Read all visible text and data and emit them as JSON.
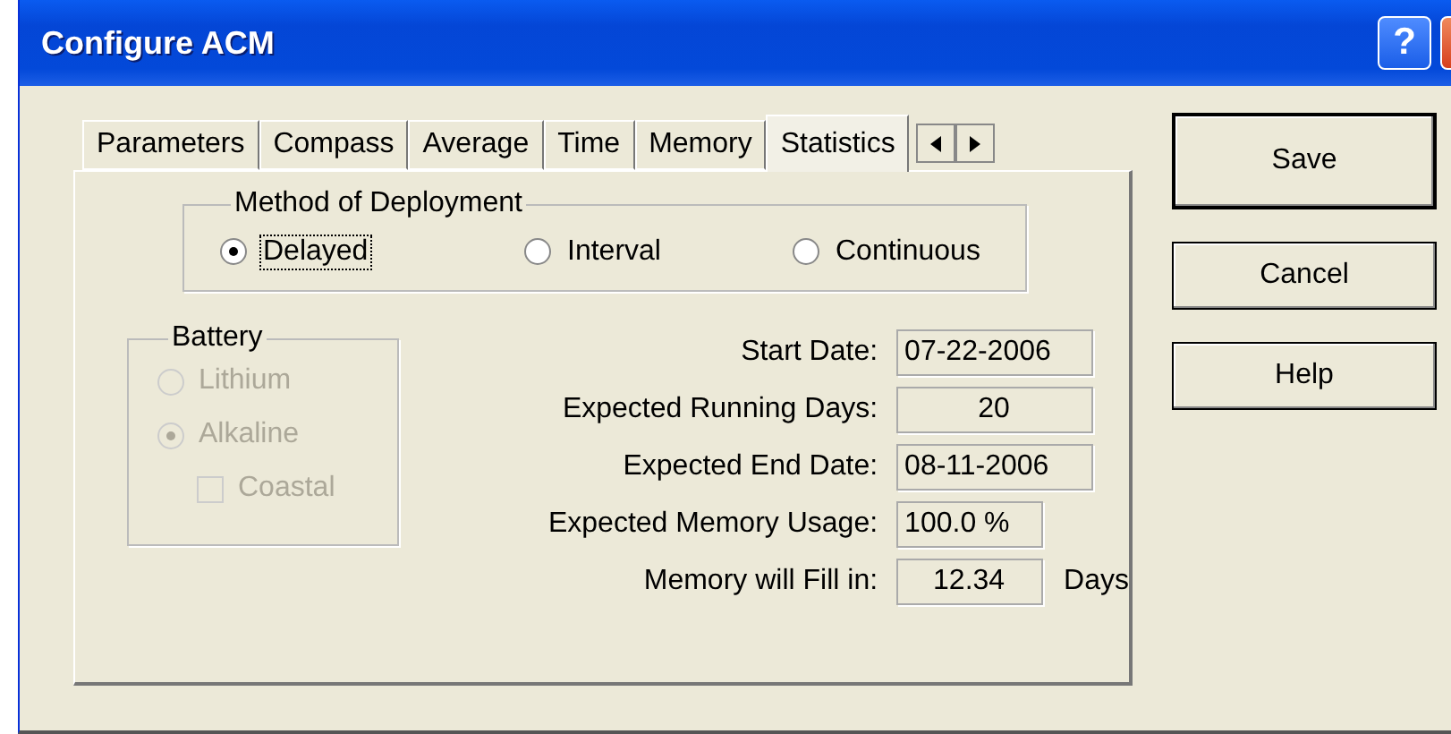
{
  "window": {
    "title": "Configure ACM",
    "help_button": "?"
  },
  "tabs": [
    {
      "label": "Parameters",
      "selected": false
    },
    {
      "label": "Compass",
      "selected": false
    },
    {
      "label": "Average",
      "selected": false
    },
    {
      "label": "Time",
      "selected": false
    },
    {
      "label": "Memory",
      "selected": false
    },
    {
      "label": "Statistics",
      "selected": true
    }
  ],
  "deployment": {
    "title": "Method of Deployment",
    "options": [
      {
        "label": "Delayed",
        "selected": true,
        "focused": true
      },
      {
        "label": "Interval",
        "selected": false,
        "focused": false
      },
      {
        "label": "Continuous",
        "selected": false,
        "focused": false
      }
    ]
  },
  "battery": {
    "title": "Battery",
    "disabled": true,
    "options": [
      {
        "label": "Lithium",
        "selected": false
      },
      {
        "label": "Alkaline",
        "selected": true
      }
    ],
    "coastal": {
      "label": "Coastal",
      "checked": false
    }
  },
  "fields": [
    {
      "label": "Start Date:",
      "value": "07-22-2006",
      "centered": false,
      "wide": true
    },
    {
      "label": "Expected Running Days:",
      "value": "20",
      "centered": true,
      "wide": true
    },
    {
      "label": "Expected End Date:",
      "value": "08-11-2006",
      "centered": false,
      "wide": true
    },
    {
      "label": "Expected Memory Usage:",
      "value": "100.0 %",
      "centered": false,
      "wide": false
    },
    {
      "label": "Memory will Fill in:",
      "value": "12.34",
      "unit": "Days",
      "centered": true,
      "wide": false
    }
  ],
  "buttons": [
    {
      "label": "Save",
      "default": true
    },
    {
      "label": "Cancel",
      "default": false
    },
    {
      "label": "Help",
      "default": false
    }
  ]
}
